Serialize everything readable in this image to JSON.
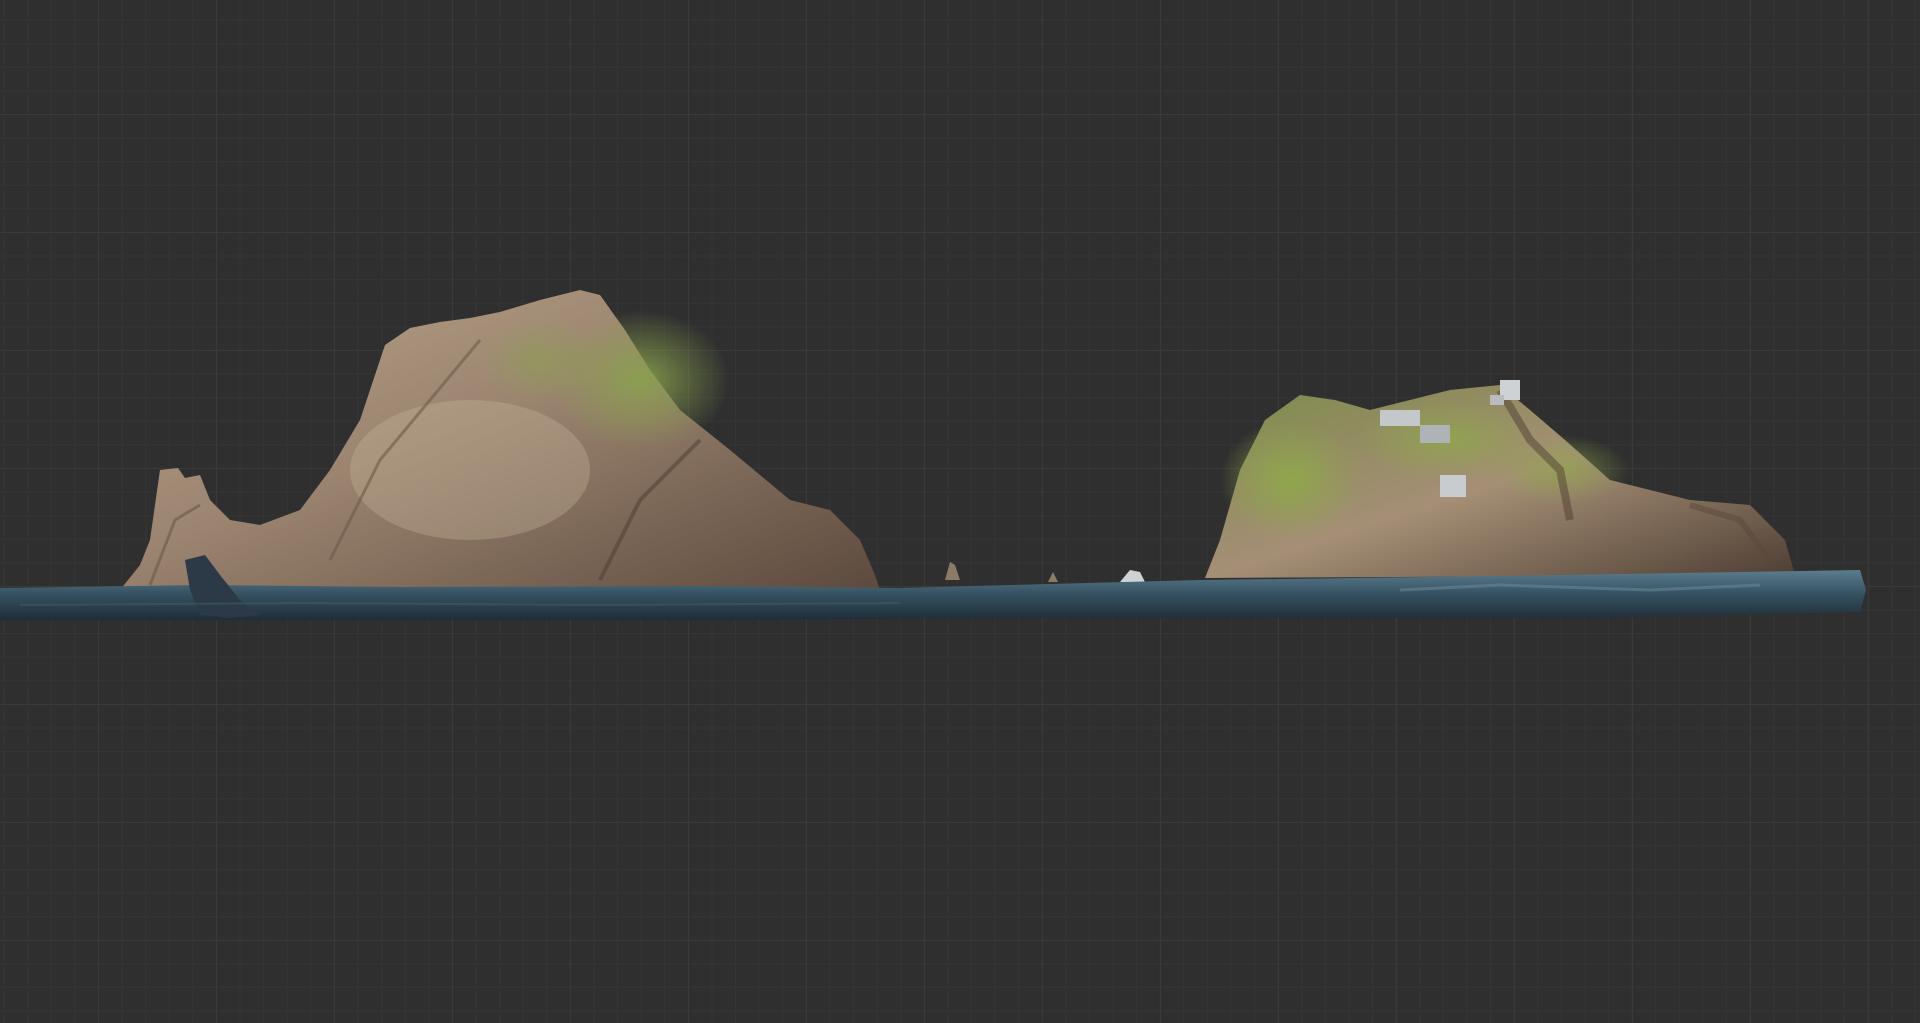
{
  "viewport": {
    "background": "#2f2f2f",
    "grid_major": "#3a3a3a",
    "grid_minor": "#353535"
  },
  "scene": {
    "objects": [
      {
        "name": "west-island",
        "colors": {
          "rock_light": "#b9a48a",
          "rock_dark": "#5c4a3d",
          "moss": "#8aa24e"
        }
      },
      {
        "name": "east-island",
        "colors": {
          "rock_light": "#a58f76",
          "rock_dark": "#4e3e33",
          "moss": "#8fa84a"
        }
      },
      {
        "name": "sea-surface",
        "colors": {
          "water_light": "#5b7d8f",
          "water_dark": "#1f2d38"
        }
      }
    ]
  }
}
